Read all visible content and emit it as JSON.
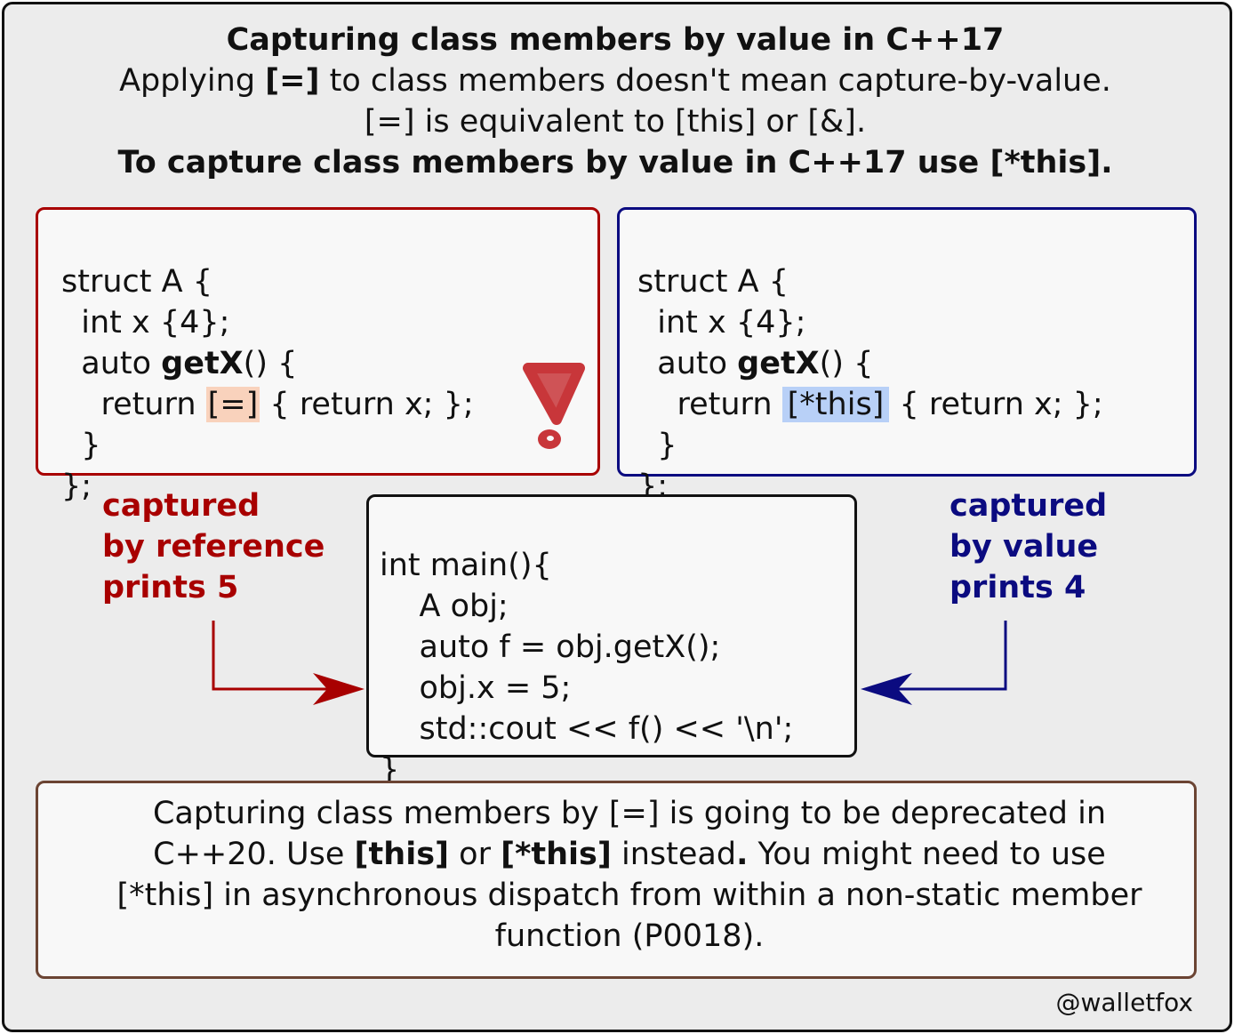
{
  "header": {
    "title": "Capturing class members by value in C++17",
    "line1_pre": "Applying ",
    "line1_bold": "[=]",
    "line1_post": " to class members doesn't mean capture-by-value.",
    "line2": "[=] is equivalent to [this] or [&].",
    "line3": "To capture class members by value in C++17 use [*this]."
  },
  "left_code": {
    "l1": "struct A {",
    "l2": "  int x {4};",
    "l3_pre": "  auto ",
    "l3_bold": "getX",
    "l3_post": "() {",
    "l4_pre": "    return ",
    "l4_hl": "[=]",
    "l4_post": " { return x; };",
    "l5": "  }",
    "l6": "};"
  },
  "right_code": {
    "l1": "struct A {",
    "l2": "  int x {4};",
    "l3_pre": "  auto ",
    "l3_bold": "getX",
    "l3_post": "() {",
    "l4_pre": "    return ",
    "l4_hl": "[*this]",
    "l4_post": " { return x; };",
    "l5": "  }",
    "l6": "};"
  },
  "main_code": {
    "l1": "int main(){",
    "l2": "    A obj;",
    "l3": "    auto f = obj.getX();",
    "l4": "    obj.x = 5;",
    "l5": "    std::cout << f() << '\\n';",
    "l6": "}"
  },
  "labels": {
    "ref": [
      "captured",
      "by reference",
      "prints 5"
    ],
    "val": [
      "captured",
      "by value",
      "prints 4"
    ]
  },
  "note": {
    "p1": "Capturing class members by [=] is going to be deprecated in C++20. Use ",
    "b1": "[this]",
    "p2": " or ",
    "b2": "[*this]",
    "p3": " instead",
    "b3": ".",
    "p4": " You might need to use [*this] in asynchronous dispatch from within a non-static member function (P0018)."
  },
  "credit": "@walletfox",
  "colors": {
    "reference": "#a80000",
    "value": "#0b0b80",
    "highlight_reference": "#f9d2bc",
    "highlight_value": "#b8d0f7",
    "note_border": "#6b4433",
    "warning": "#c8363a"
  },
  "icons": {
    "warning": "exclamation-mark-icon"
  }
}
